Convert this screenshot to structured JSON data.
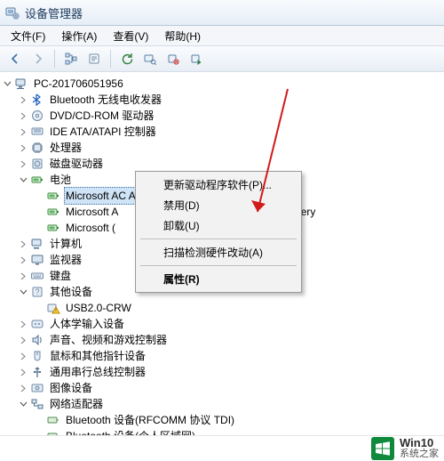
{
  "window": {
    "title": "设备管理器"
  },
  "menu": {
    "file": "文件(F)",
    "action": "操作(A)",
    "view": "查看(V)",
    "help": "帮助(H)"
  },
  "toolbar_icons": {
    "back": "back-arrow",
    "fwd": "forward-arrow",
    "up": "up-level",
    "treeview": "tree-view",
    "props": "properties",
    "refresh": "refresh",
    "scan": "scan-hardware",
    "help": "help"
  },
  "tree": {
    "root": "PC-201706051956",
    "nodes": [
      {
        "icon": "bluetooth",
        "label": "Bluetooth 无线电收发器",
        "exp": "closed"
      },
      {
        "icon": "dvd",
        "label": "DVD/CD-ROM 驱动器",
        "exp": "closed"
      },
      {
        "icon": "ide",
        "label": "IDE ATA/ATAPI 控制器",
        "exp": "closed"
      },
      {
        "icon": "cpu",
        "label": "处理器",
        "exp": "closed"
      },
      {
        "icon": "disk",
        "label": "磁盘驱动器",
        "exp": "closed"
      },
      {
        "icon": "battery",
        "label": "电池",
        "exp": "open",
        "children": [
          {
            "icon": "battery",
            "label": "Microsoft AC Adapter",
            "selected": true
          },
          {
            "icon": "battery",
            "label": "Microsoft A",
            "trailing": "tery"
          },
          {
            "icon": "battery",
            "label": "Microsoft ("
          }
        ]
      },
      {
        "icon": "computer",
        "label": "计算机",
        "exp": "closed"
      },
      {
        "icon": "monitor",
        "label": "监视器",
        "exp": "closed"
      },
      {
        "icon": "keyboard",
        "label": "键盘",
        "exp": "closed"
      },
      {
        "icon": "other",
        "label": "其他设备",
        "exp": "open",
        "children": [
          {
            "icon": "warn",
            "label": "USB2.0-CRW"
          }
        ]
      },
      {
        "icon": "hid",
        "label": "人体学输入设备",
        "exp": "closed"
      },
      {
        "icon": "sound",
        "label": "声音、视频和游戏控制器",
        "exp": "closed"
      },
      {
        "icon": "mouse",
        "label": "鼠标和其他指针设备",
        "exp": "closed"
      },
      {
        "icon": "usb",
        "label": "通用串行总线控制器",
        "exp": "closed"
      },
      {
        "icon": "image",
        "label": "图像设备",
        "exp": "closed"
      },
      {
        "icon": "network",
        "label": "网络适配器",
        "exp": "open",
        "children": [
          {
            "icon": "net",
            "label": "Bluetooth 设备(RFCOMM 协议 TDI)"
          },
          {
            "icon": "net",
            "label": "Bluetooth 设备(个人区域网)"
          }
        ]
      }
    ]
  },
  "context_menu": {
    "update": "更新驱动程序软件(P)...",
    "disable": "禁用(D)",
    "uninstall": "卸载(U)",
    "scan": "扫描检测硬件改动(A)",
    "props": "属性(R)"
  },
  "footer": {
    "blurb": "",
    "brand_top": "Win10",
    "brand_bottom": "系统之家"
  },
  "colors": {
    "accent": "#0f8a3c",
    "arrow": "#d21a1a"
  }
}
